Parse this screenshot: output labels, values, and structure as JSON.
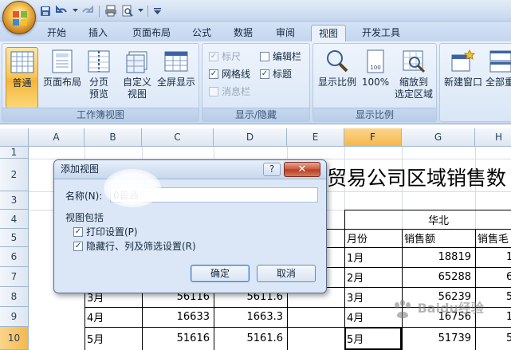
{
  "quick_access": {
    "icons": [
      "office-logo-icon",
      "save-icon",
      "undo-icon",
      "print-icon",
      "print-preview-icon",
      "customize-qat-icon"
    ]
  },
  "tabs": [
    "开始",
    "插入",
    "页面布局",
    "公式",
    "数据",
    "审阅",
    "视图",
    "开发工具"
  ],
  "active_tab": "视图",
  "ribbon": {
    "workbook_views": {
      "label": "工作簿视图",
      "normal": "普通",
      "page_layout": "页面布局",
      "page_break_preview_1": "分页",
      "page_break_preview_2": "预览",
      "custom_views_1": "自定义",
      "custom_views_2": "视图",
      "full_screen": "全屏显示"
    },
    "show_hide": {
      "label": "显示/隐藏",
      "ruler": "标尺",
      "formula_bar": "编辑栏",
      "gridlines": "网格线",
      "headings": "标题",
      "message_bar": "消息栏"
    },
    "zoom": {
      "label": "显示比例",
      "zoom": "显示比例",
      "zoom_100": "100%",
      "zoom_selection_1": "缩放到",
      "zoom_selection_2": "选定区域"
    },
    "window": {
      "new_window": "新建窗口",
      "arrange_all": "全部重"
    }
  },
  "sheet": {
    "columns": [
      "A",
      "B",
      "C",
      "D",
      "E",
      "F",
      "G",
      "H"
    ],
    "rows": [
      "1",
      "2",
      "3",
      "4",
      "5",
      "6",
      "7",
      "8",
      "9",
      "10"
    ],
    "selected_column": "F",
    "selected_row": "10",
    "title_text": "贸易公司区域销售数",
    "region": "华北",
    "header_month": "月份",
    "header_sales": "销售额",
    "header_margin": "销售毛",
    "left_rows": [
      {
        "month": "3月",
        "sales": "56116",
        "margin": "5611.6"
      },
      {
        "month": "4月",
        "sales": "16633",
        "margin": "1663.3"
      },
      {
        "month": "5月",
        "sales": "51616",
        "margin": "5161.6"
      }
    ],
    "right_rows": [
      {
        "month": "1月",
        "sales": "18819",
        "h": "1"
      },
      {
        "month": "2月",
        "sales": "65288",
        "h": "6"
      },
      {
        "month": "3月",
        "sales": "56239",
        "h": "5"
      },
      {
        "month": "4月",
        "sales": "16756",
        "h": "1"
      },
      {
        "month": "5月",
        "sales": "51739",
        "h": "5"
      }
    ]
  },
  "dialog": {
    "title": "添加视图",
    "help": "?",
    "close": "✕",
    "name_label": "名称(N):",
    "name_value": "0普通",
    "include_label": "视图包括",
    "option_print": "打印设置(P)",
    "option_hidden": "隐藏行、列及筛选设置(R)",
    "ok": "确定",
    "cancel": "取消"
  },
  "watermark": {
    "text": "Baidu经验"
  }
}
